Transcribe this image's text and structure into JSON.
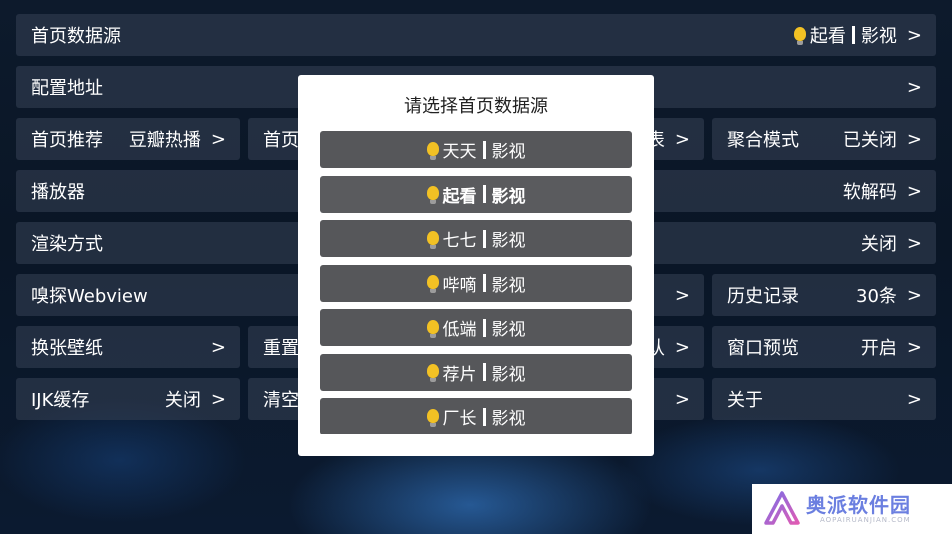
{
  "rows": {
    "home_source": {
      "label": "首页数据源",
      "value_pre": "起看",
      "value_post": "影视",
      "chevron": ">"
    },
    "config_url": {
      "label": "配置地址",
      "chevron": ">"
    },
    "home_recommend": {
      "label": "首页推荐",
      "value": "豆瓣热播",
      "chevron": ">"
    },
    "home_partial": {
      "label": "首页"
    },
    "list_partial": {
      "value": "表",
      "chevron": ">"
    },
    "aggregate": {
      "label": "聚合模式",
      "value": "已关闭",
      "chevron": ">"
    },
    "player": {
      "label": "播放器",
      "value": "软解码",
      "chevron": ">"
    },
    "render": {
      "label": "渲染方式",
      "value": "关闭",
      "chevron": ">"
    },
    "sniff": {
      "label": "嗅探Webview"
    },
    "sniff_partial": {
      "chevron": ">"
    },
    "history": {
      "label": "历史记录",
      "value": "30条",
      "chevron": ">"
    },
    "wallpaper": {
      "label": "换张壁纸",
      "chevron": ">"
    },
    "reset_partial": {
      "label": "重置"
    },
    "default_partial": {
      "value": "认",
      "chevron": ">"
    },
    "window_preview": {
      "label": "窗口预览",
      "value": "开启",
      "chevron": ">"
    },
    "ijk_cache": {
      "label": "IJK缓存",
      "value": "关闭",
      "chevron": ">"
    },
    "clear_partial": {
      "label": "清空"
    },
    "clear_right_partial": {
      "chevron": ">"
    },
    "about": {
      "label": "关于",
      "chevron": ">"
    }
  },
  "dialog": {
    "title": "请选择首页数据源",
    "options": [
      {
        "name": "天天",
        "suffix": "影视",
        "selected": false
      },
      {
        "name": "起看",
        "suffix": "影视",
        "selected": true
      },
      {
        "name": "七七",
        "suffix": "影视",
        "selected": false
      },
      {
        "name": "哔嘀",
        "suffix": "影视",
        "selected": false
      },
      {
        "name": "低端",
        "suffix": "影视",
        "selected": false
      },
      {
        "name": "荐片",
        "suffix": "影视",
        "selected": false
      },
      {
        "name": "厂长",
        "suffix": "影视",
        "selected": false
      }
    ]
  },
  "watermark": {
    "title": "奥派软件园",
    "subtitle": "AOPAIRUANJIAN.COM"
  },
  "colors": {
    "bulb": "#f2c124",
    "dialog_option_bg": "#56575a",
    "row_bg": "#323e50"
  }
}
